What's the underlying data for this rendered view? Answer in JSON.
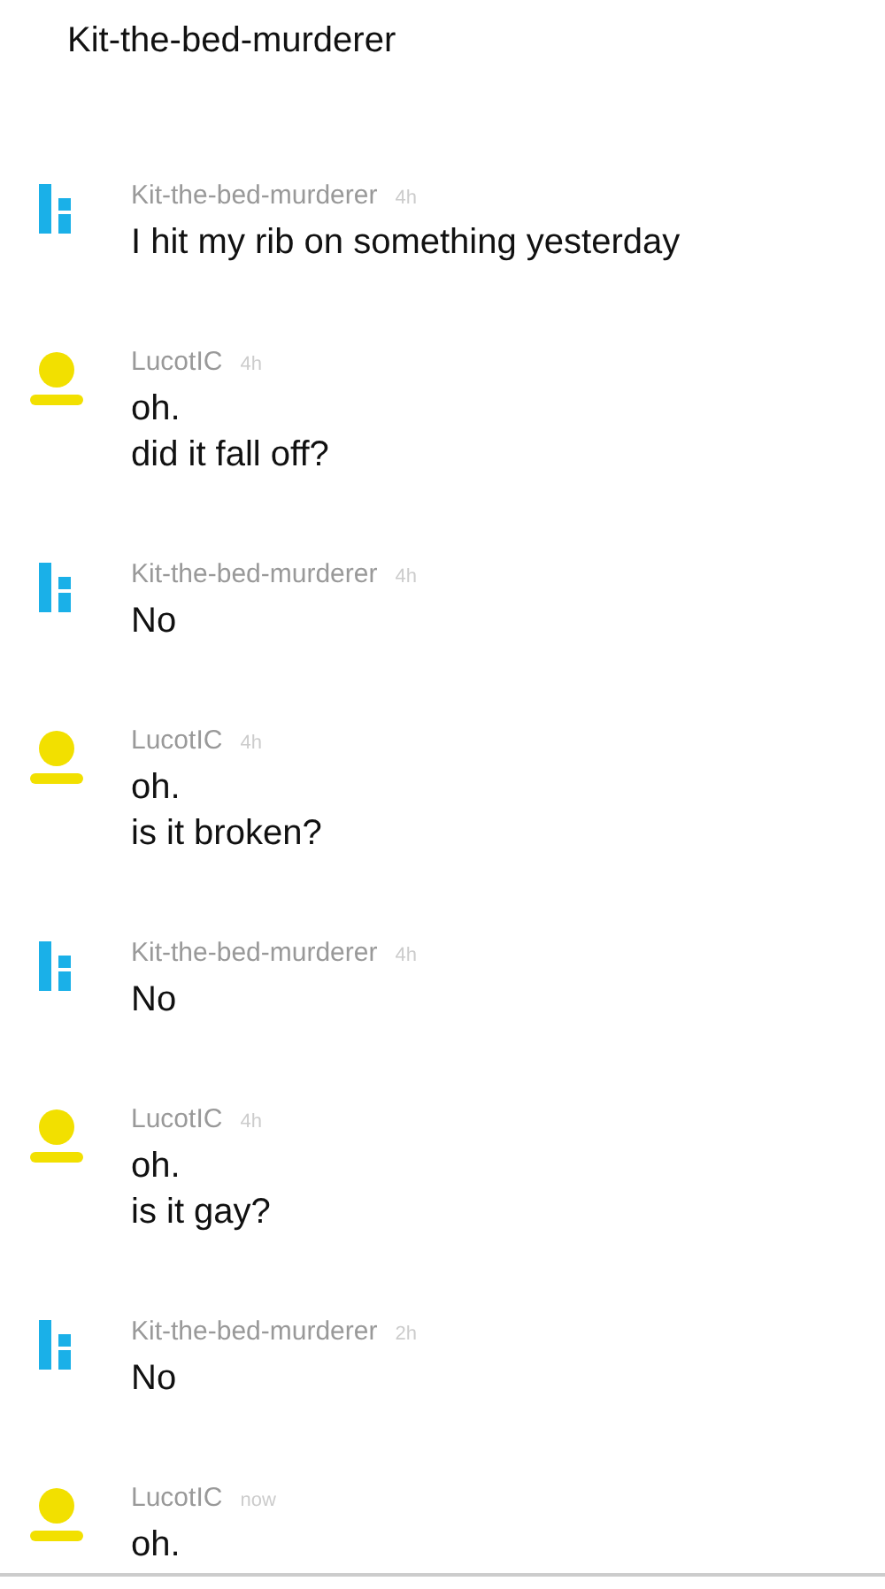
{
  "header": {
    "title": "Kit-the-bed-murderer"
  },
  "messages": [
    {
      "kind": "logo",
      "author": "Kit-the-bed-murderer",
      "time": "4h",
      "lines": [
        "I hit my rib on something yesterday"
      ]
    },
    {
      "kind": "person",
      "author": "LucotIC",
      "time": "4h",
      "lines": [
        "oh.",
        "did it fall off?"
      ]
    },
    {
      "kind": "logo",
      "author": "Kit-the-bed-murderer",
      "time": "4h",
      "lines": [
        "No"
      ]
    },
    {
      "kind": "person",
      "author": "LucotIC",
      "time": "4h",
      "lines": [
        "oh.",
        "is it broken?"
      ]
    },
    {
      "kind": "logo",
      "author": "Kit-the-bed-murderer",
      "time": "4h",
      "lines": [
        "No"
      ]
    },
    {
      "kind": "person",
      "author": "LucotIC",
      "time": "4h",
      "lines": [
        "oh.",
        "is it gay?"
      ]
    },
    {
      "kind": "logo",
      "author": "Kit-the-bed-murderer",
      "time": "2h",
      "lines": [
        "No"
      ]
    },
    {
      "kind": "person",
      "author": "LucotIC",
      "time": "now",
      "lines": [
        "oh."
      ]
    }
  ]
}
